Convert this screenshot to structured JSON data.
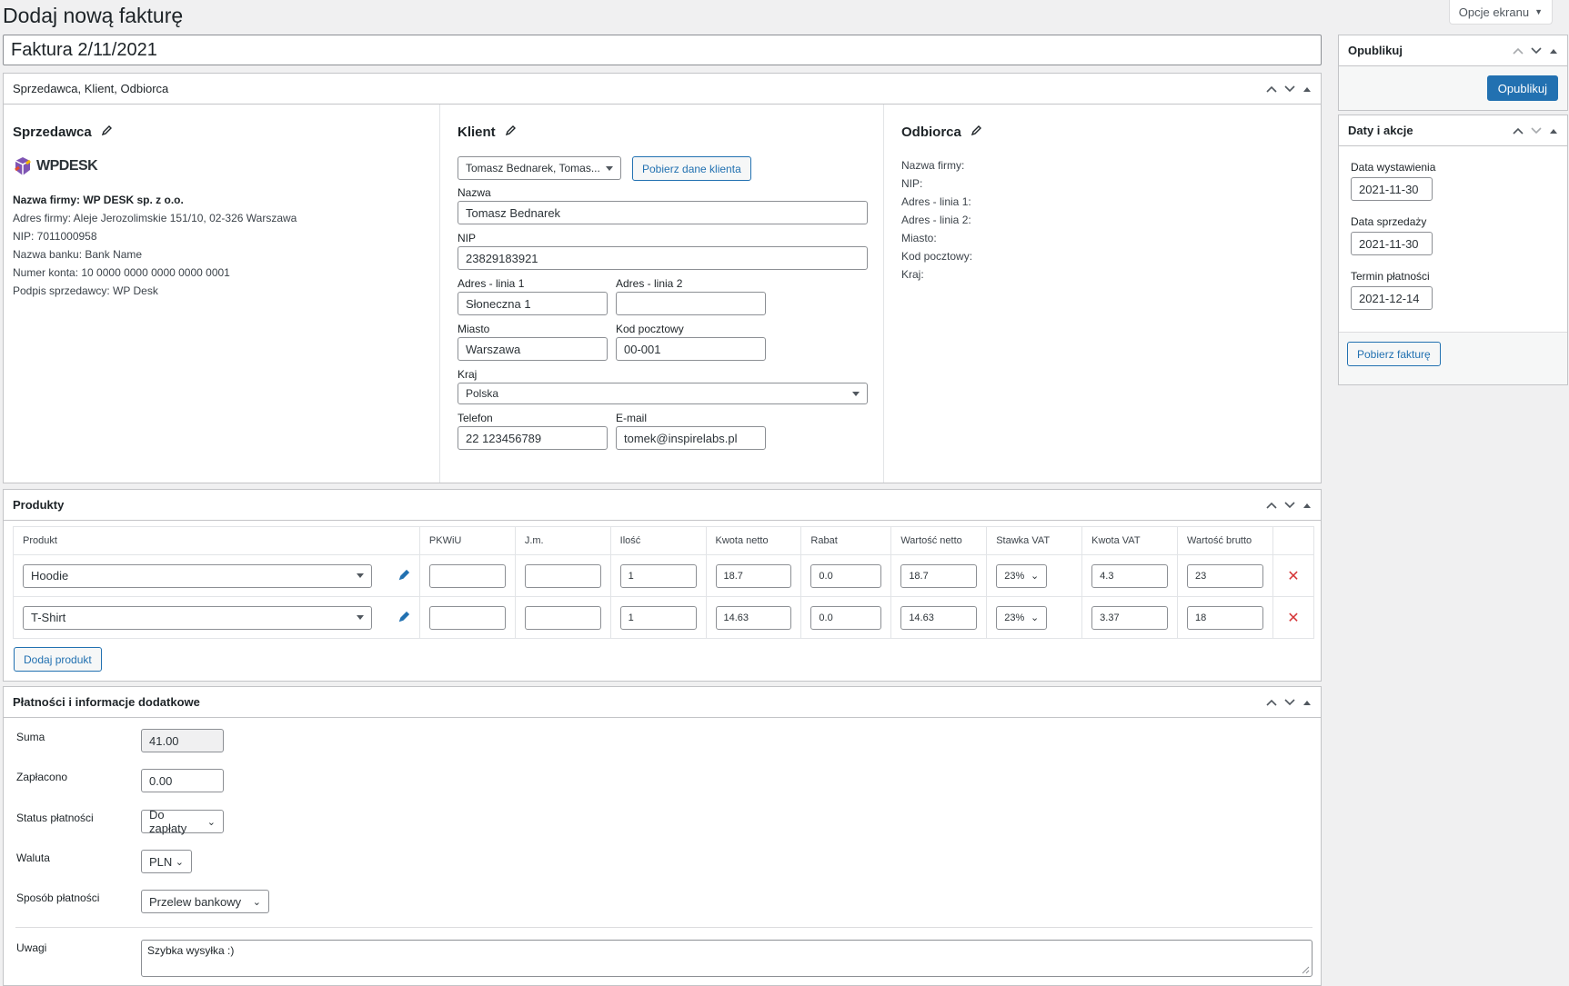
{
  "header": {
    "page_title": "Dodaj nową fakturę",
    "screen_options": "Opcje ekranu"
  },
  "invoice_title": "Faktura 2/11/2021",
  "parties_box": {
    "title": "Sprzedawca, Klient, Odbiorca",
    "seller": {
      "heading": "Sprzedawca",
      "logo_text": "WPDESK",
      "company": "Nazwa firmy: WP DESK sp. z o.o.",
      "address": "Adres firmy: Aleje Jerozolimskie 151/10, 02-326 Warszawa",
      "nip": "NIP: 7011000958",
      "bank": "Nazwa banku: Bank Name",
      "account": "Numer konta: 10 0000 0000 0000 0000 0001",
      "signature": "Podpis sprzedawcy: WP Desk"
    },
    "client": {
      "heading": "Klient",
      "select_value": "Tomasz Bednarek, Tomas...",
      "fetch_button": "Pobierz dane klienta",
      "name_label": "Nazwa",
      "name_value": "Tomasz Bednarek",
      "nip_label": "NIP",
      "nip_value": "23829183921",
      "addr1_label": "Adres - linia 1",
      "addr1_value": "Słoneczna 1",
      "addr2_label": "Adres - linia 2",
      "addr2_value": "",
      "city_label": "Miasto",
      "city_value": "Warszawa",
      "postal_label": "Kod pocztowy",
      "postal_value": "00-001",
      "country_label": "Kraj",
      "country_value": "Polska",
      "phone_label": "Telefon",
      "phone_value": "22 123456789",
      "email_label": "E-mail",
      "email_value": "tomek@inspirelabs.pl"
    },
    "recipient": {
      "heading": "Odbiorca",
      "lines": [
        "Nazwa firmy:",
        "NIP:",
        "Adres - linia 1:",
        "Adres - linia 2:",
        "Miasto:",
        "Kod pocztowy:",
        "Kraj:"
      ]
    }
  },
  "products_box": {
    "title": "Produkty",
    "columns": [
      "Produkt",
      "PKWiU",
      "J.m.",
      "Ilość",
      "Kwota netto",
      "Rabat",
      "Wartość netto",
      "Stawka VAT",
      "Kwota VAT",
      "Wartość brutto"
    ],
    "rows": [
      {
        "product": "Hoodie",
        "pkwiu": "",
        "unit": "",
        "qty": "1",
        "net_price": "18.7",
        "discount": "0.0",
        "net_value": "18.7",
        "vat_rate": "23%",
        "vat_amount": "4.3",
        "gross": "23"
      },
      {
        "product": "T-Shirt",
        "pkwiu": "",
        "unit": "",
        "qty": "1",
        "net_price": "14.63",
        "discount": "0.0",
        "net_value": "14.63",
        "vat_rate": "23%",
        "vat_amount": "3.37",
        "gross": "18"
      }
    ],
    "add_button": "Dodaj produkt"
  },
  "payment_box": {
    "title": "Płatności i informacje dodatkowe",
    "sum_label": "Suma",
    "sum_value": "41.00",
    "paid_label": "Zapłacono",
    "paid_value": "0.00",
    "status_label": "Status płatności",
    "status_value": "Do zapłaty",
    "currency_label": "Waluta",
    "currency_value": "PLN",
    "method_label": "Sposób płatności",
    "method_value": "Przelew bankowy",
    "notes_label": "Uwagi",
    "notes_value": "Szybka wysyłka :)"
  },
  "publish_box": {
    "title": "Opublikuj",
    "button": "Opublikuj"
  },
  "dates_box": {
    "title": "Daty i akcje",
    "issue_label": "Data wystawienia",
    "issue_value": "2021-11-30",
    "sale_label": "Data sprzedaży",
    "sale_value": "2021-11-30",
    "due_label": "Termin płatności",
    "due_value": "2021-12-14",
    "download_button": "Pobierz fakturę"
  },
  "colors": {
    "primary": "#2271b1",
    "danger": "#d63638",
    "background": "#f0f0f1"
  }
}
